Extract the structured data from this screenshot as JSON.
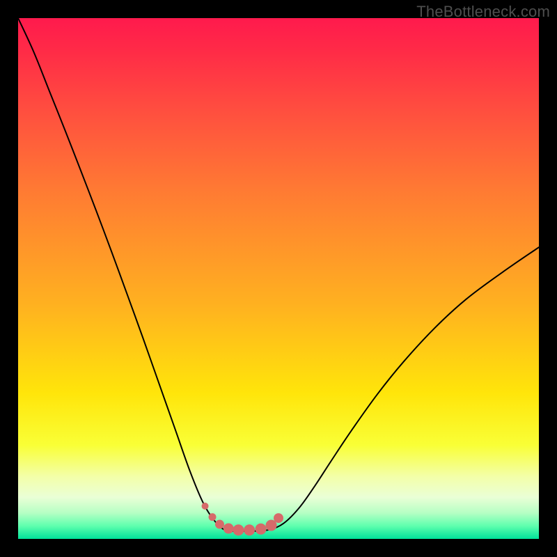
{
  "watermark": "TheBottleneck.com",
  "colors": {
    "frame_bg": "#000000",
    "curve_stroke": "#000000",
    "marker_fill": "#d66a6a",
    "gradient_top": "#ff1a4d",
    "gradient_bottom": "#00e29a"
  },
  "chart_data": {
    "type": "line",
    "title": "",
    "xlabel": "",
    "ylabel": "",
    "xlim": [
      0,
      1
    ],
    "ylim": [
      0,
      100
    ],
    "note": "x is normalized horizontal position across the plot (0=left, 1=right); y is the curve height as a percentage of the plot height (0=bottom, 100=top). Values are read off the image at the gridline precision it implies.",
    "series": [
      {
        "name": "bottleneck-curve",
        "x": [
          0.0,
          0.03,
          0.06,
          0.09,
          0.12,
          0.15,
          0.18,
          0.21,
          0.24,
          0.27,
          0.3,
          0.33,
          0.355,
          0.377,
          0.395,
          0.41,
          0.43,
          0.455,
          0.483,
          0.51,
          0.54,
          0.57,
          0.6,
          0.64,
          0.69,
          0.74,
          0.8,
          0.86,
          0.93,
          1.0
        ],
        "values": [
          100.0,
          93.5,
          86.0,
          78.5,
          70.8,
          63.0,
          55.0,
          46.8,
          38.5,
          30.0,
          21.5,
          13.0,
          7.0,
          3.5,
          1.8,
          1.5,
          1.5,
          1.5,
          1.8,
          3.0,
          6.0,
          10.2,
          14.8,
          20.8,
          27.8,
          34.0,
          40.5,
          46.0,
          51.2,
          56.0
        ]
      }
    ],
    "markers": {
      "name": "valley-markers",
      "x": [
        0.359,
        0.373,
        0.387,
        0.404,
        0.423,
        0.444,
        0.466,
        0.486,
        0.5
      ],
      "values": [
        6.3,
        4.2,
        2.8,
        2.0,
        1.7,
        1.7,
        1.9,
        2.6,
        4.0
      ],
      "radius_px": [
        5.0,
        5.5,
        6.5,
        7.5,
        8.0,
        8.0,
        8.0,
        8.0,
        7.0
      ]
    }
  }
}
